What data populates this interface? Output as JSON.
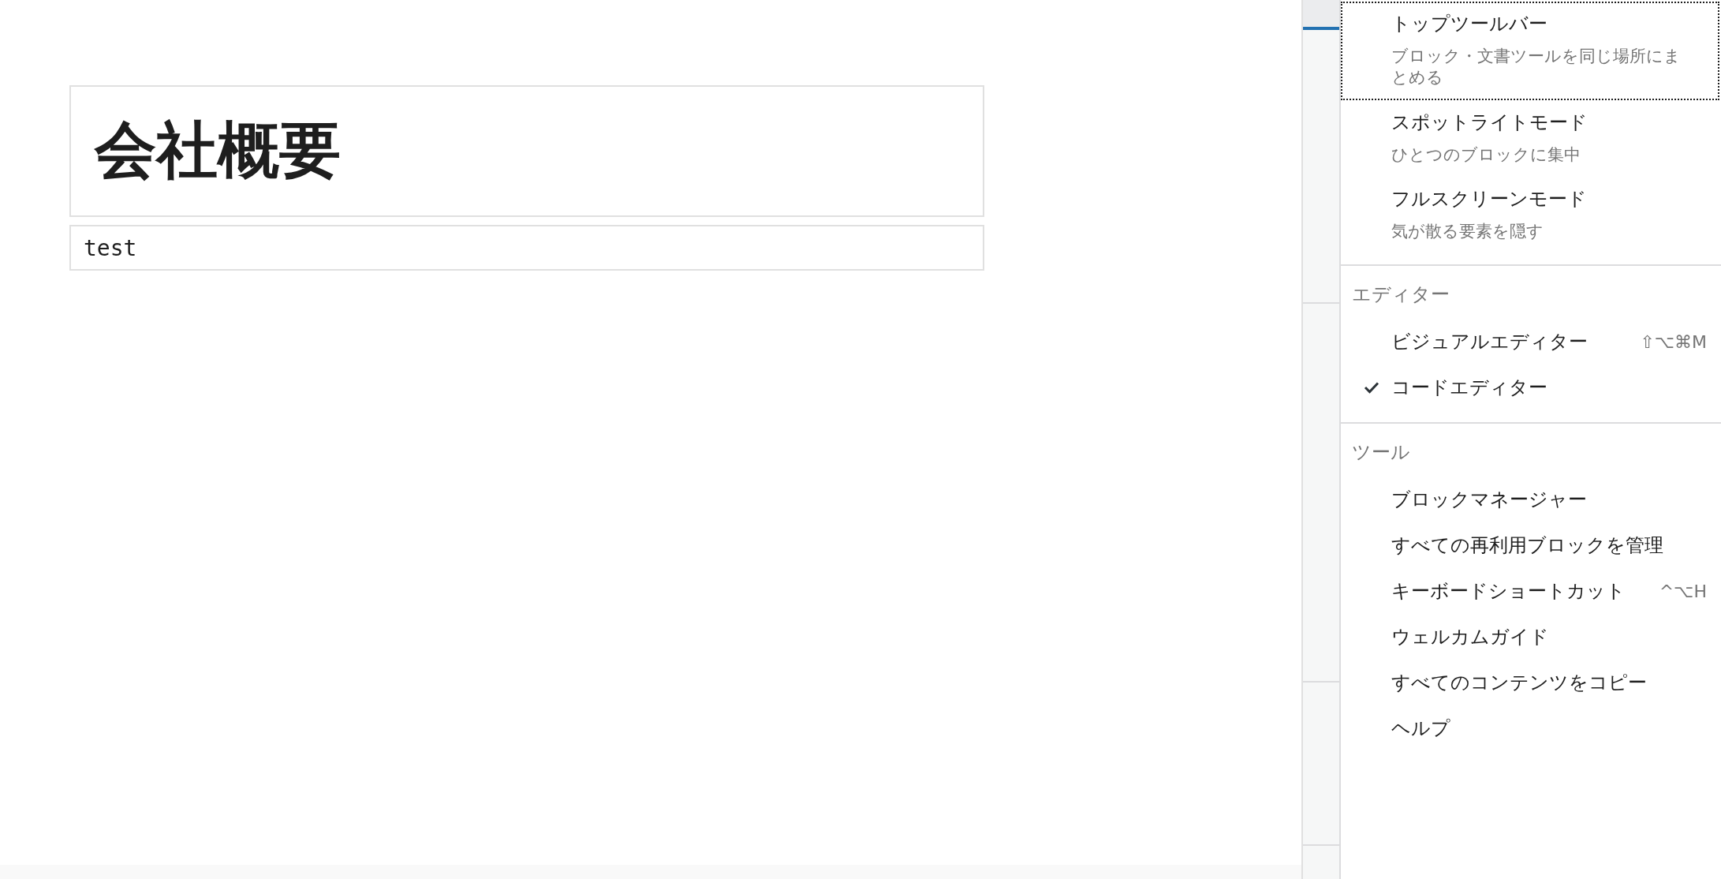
{
  "editor": {
    "title": "会社概要",
    "code": "test"
  },
  "menu": {
    "groups": [
      {
        "items": [
          {
            "label": "トップツールバー",
            "description": "ブロック・文書ツールを同じ場所にまとめる",
            "focused": true
          },
          {
            "label": "スポットライトモード",
            "description": "ひとつのブロックに集中",
            "focused": false
          },
          {
            "label": "フルスクリーンモード",
            "description": "気が散る要素を隠す",
            "focused": false
          }
        ]
      },
      {
        "heading": "エディター",
        "items": [
          {
            "label": "ビジュアルエディター",
            "shortcut": "⇧⌥⌘M",
            "selected": false
          },
          {
            "label": "コードエディター",
            "selected": true
          }
        ]
      },
      {
        "heading": "ツール",
        "items": [
          {
            "label": "ブロックマネージャー"
          },
          {
            "label": "すべての再利用ブロックを管理"
          },
          {
            "label": "キーボードショートカット",
            "shortcut": "^⌥H"
          },
          {
            "label": "ウェルカムガイド"
          },
          {
            "label": "すべてのコンテンツをコピー"
          },
          {
            "label": "ヘルプ"
          }
        ]
      }
    ]
  }
}
